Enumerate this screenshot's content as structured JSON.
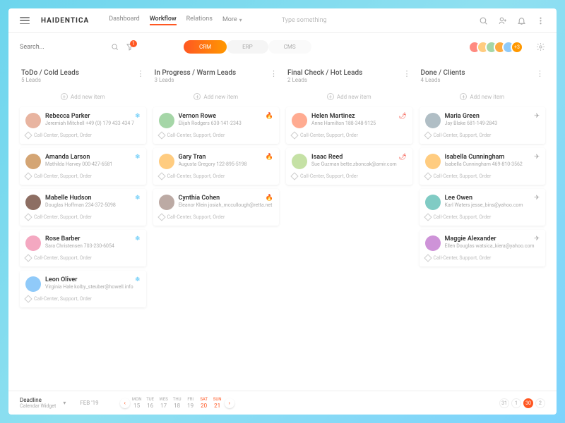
{
  "logo": "HAIDENTICA",
  "nav": [
    {
      "label": "Dashboard"
    },
    {
      "label": "Workflow",
      "active": true
    },
    {
      "label": "Relations"
    },
    {
      "label": "More",
      "more": true
    }
  ],
  "topsearch_placeholder": "Type something",
  "search_placeholder": "Search...",
  "filter_badge": "1",
  "pills": [
    {
      "label": "CRM",
      "active": true
    },
    {
      "label": "ERP"
    },
    {
      "label": "CMS"
    }
  ],
  "avatars_more": "+3",
  "columns": [
    {
      "title": "ToDo / Cold Leads",
      "sub": "5 Leads",
      "add": "Add new item",
      "icon": "❄",
      "iconColor": "#4fc3f7",
      "cards": [
        {
          "name": "Rebecca Parker",
          "meta": "Jeremiah Mitchell   +49 (0) 179 433 434 7",
          "tags": "Call-Center,  Support,  Order",
          "color": "#e8b4a0"
        },
        {
          "name": "Amanda Larson",
          "meta": "Mathilda Harvey   000-427-6581",
          "tags": "Call-Center,  Support,  Order",
          "color": "#d4a574"
        },
        {
          "name": "Mabelle Hudson",
          "meta": "Douglas Hoffman   234-372-5098",
          "tags": "Call-Center,  Support,  Order",
          "color": "#8d6e63"
        },
        {
          "name": "Rose Barber",
          "meta": "Sara Christensen   703-230-6054",
          "tags": "Call-Center,  Support,  Order",
          "color": "#f4a8c1"
        },
        {
          "name": "Leon Oliver",
          "meta": "Virginia Hale   kolby_steuber@howell.info",
          "tags": "Call-Center,  Support,  Order",
          "color": "#90caf9"
        }
      ]
    },
    {
      "title": "In Progress / Warm Leads",
      "sub": "3 Leads",
      "add": "Add new item",
      "icon": "🔥",
      "iconColor": "#ff7043",
      "cards": [
        {
          "name": "Vernon Rowe",
          "meta": "Elijah Rodgers   630-141-2343",
          "tags": "Call-Center,  Support,  Order",
          "color": "#a5d6a7"
        },
        {
          "name": "Gary Tran",
          "meta": "Augusta Gregory   122-895-5198",
          "tags": "Call-Center,  Support,  Order",
          "color": "#ffcc80"
        },
        {
          "name": "Cynthia Cohen",
          "meta": "Eleanor Klein   josiah_mccullough@retta.net",
          "tags": "Call-Center,  Support,  Order",
          "color": "#bcaaa4"
        }
      ]
    },
    {
      "title": "Final Check / Hot Leads",
      "sub": "2 Leads",
      "add": "Add new item",
      "icon": "🌶",
      "iconColor": "#f44336",
      "cards": [
        {
          "name": "Helen Martinez",
          "meta": "Anne Hamilton   188-348-9125",
          "tags": "Call-Center,  Support,  Order",
          "color": "#ffab91"
        },
        {
          "name": "Isaac Reed",
          "meta": "Sue Guzman   bette.zboncak@amir.com",
          "tags": "Call-Center,  Support,  Order",
          "color": "#c5e1a5"
        }
      ]
    },
    {
      "title": "Done / Clients",
      "sub": "4 Leads",
      "add": "Add new item",
      "icon": "✈",
      "iconColor": "#9e9e9e",
      "cards": [
        {
          "name": "Maria Green",
          "meta": "Jay Blake   681-149-2843",
          "tags": "Call-Center,  Support,  Order",
          "color": "#b0bec5"
        },
        {
          "name": "Isabella Cunningham",
          "meta": "Isabella Cunningham   469-810-3562",
          "tags": "Call-Center,  Support,  Order",
          "color": "#ffcc80"
        },
        {
          "name": "Lee Owen",
          "meta": "Karl Waters   jesse_bins@yahoo.com",
          "tags": "Call-Center,  Support,  Order",
          "color": "#80cbc4"
        },
        {
          "name": "Maggie Alexander",
          "meta": "Ellen Douglas   watsica_kiera@yahoo.com",
          "tags": "Call-Center,  Support,  Order",
          "color": "#ce93d8"
        }
      ]
    }
  ],
  "footer": {
    "deadline": "Deadline",
    "deadline_sub": "Calendar Widget",
    "month": "FEB '19",
    "days": [
      {
        "w": "MON",
        "n": "15"
      },
      {
        "w": "TUE",
        "n": "16"
      },
      {
        "w": "WES",
        "n": "17"
      },
      {
        "w": "THU",
        "n": "18"
      },
      {
        "w": "FRI",
        "n": "19"
      },
      {
        "w": "SAT",
        "n": "20",
        "wk": true
      },
      {
        "w": "SUN",
        "n": "21",
        "wk": true
      }
    ],
    "pages": [
      "31",
      "1",
      "30",
      "2"
    ]
  },
  "avatar_colors": [
    "#ff8a80",
    "#ffcc80",
    "#a5d6a7",
    "#ffab40",
    "#90caf9"
  ]
}
